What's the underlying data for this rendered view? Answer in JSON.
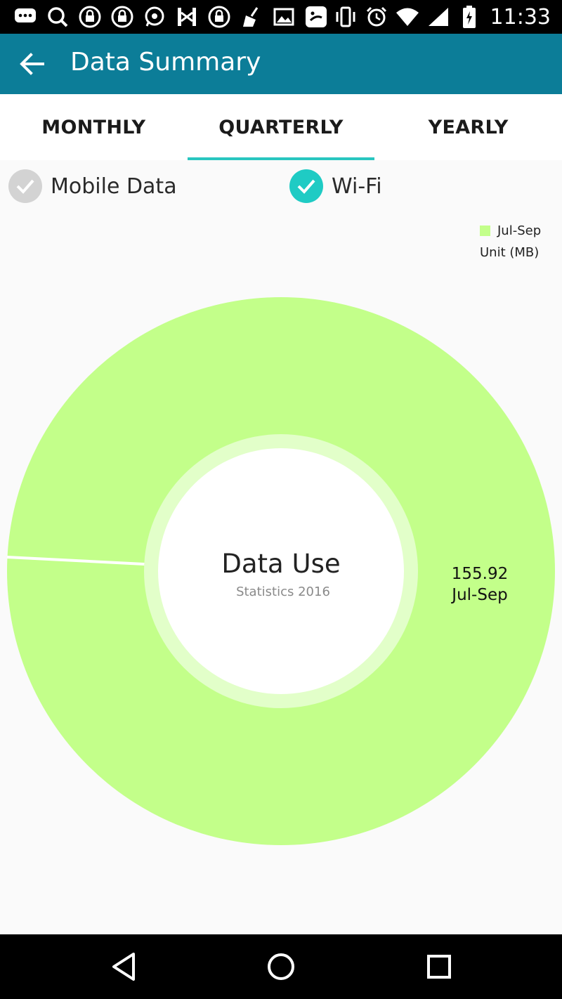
{
  "status_bar": {
    "time": "11:33",
    "icons": [
      "chat-icon",
      "search-icon",
      "lock-icon",
      "lock-icon",
      "whatsapp-icon",
      "transfer-icon",
      "lock-icon",
      "broom-icon",
      "image-icon",
      "face-icon"
    ],
    "right_icons": [
      "vibrate-icon",
      "alarm-icon",
      "wifi-icon",
      "signal-icon",
      "battery-icon"
    ]
  },
  "app_bar": {
    "title": "Data Summary",
    "color": "#0c7d98"
  },
  "tabs": [
    {
      "label": "MONTHLY",
      "active": false
    },
    {
      "label": "QUARTERLY",
      "active": true
    },
    {
      "label": "YEARLY",
      "active": false
    }
  ],
  "filters": {
    "mobile_data": {
      "label": "Mobile Data",
      "checked": false
    },
    "wifi": {
      "label": "Wi-Fi",
      "checked": true
    }
  },
  "legend": {
    "label": "Jul-Sep",
    "unit": "Unit (MB)"
  },
  "center": {
    "title": "Data Use",
    "subtitle": "Statistics 2016"
  },
  "chart_data": {
    "type": "pie",
    "donut": true,
    "categories": [
      "Jul-Sep"
    ],
    "values": [
      155.92
    ],
    "unit": "MB",
    "colors": [
      "#c3ff8a"
    ],
    "slice_labels": [
      {
        "value": "155.92",
        "category": "Jul-Sep"
      }
    ],
    "legend": "top-right"
  }
}
